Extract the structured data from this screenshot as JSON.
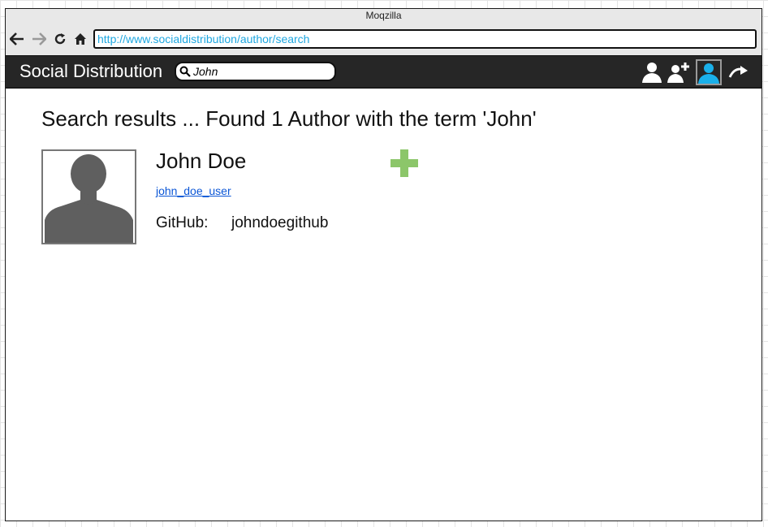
{
  "browser": {
    "title": "Moqzilla",
    "url": "http://www.socialdistribution/author/search"
  },
  "app": {
    "brand": "Social Distribution",
    "search_value": "John"
  },
  "results": {
    "heading": "Search results ... Found 1 Author with the term 'John'",
    "authors": [
      {
        "name": "John Doe",
        "username": "john_doe_user",
        "github_label": "GitHub:",
        "github": "johndoegithub"
      }
    ]
  },
  "colors": {
    "appbar": "#262626",
    "url_text": "#1ea7e0",
    "active_icon": "#1ab0ea",
    "add_icon": "#8cc66a",
    "link": "#0b56d6"
  },
  "icons": [
    "back-arrow-icon",
    "forward-arrow-icon",
    "refresh-icon",
    "home-icon",
    "search-icon",
    "profile-icon",
    "add-friend-icon",
    "active-user-icon",
    "logout-icon",
    "add-plus-icon"
  ]
}
